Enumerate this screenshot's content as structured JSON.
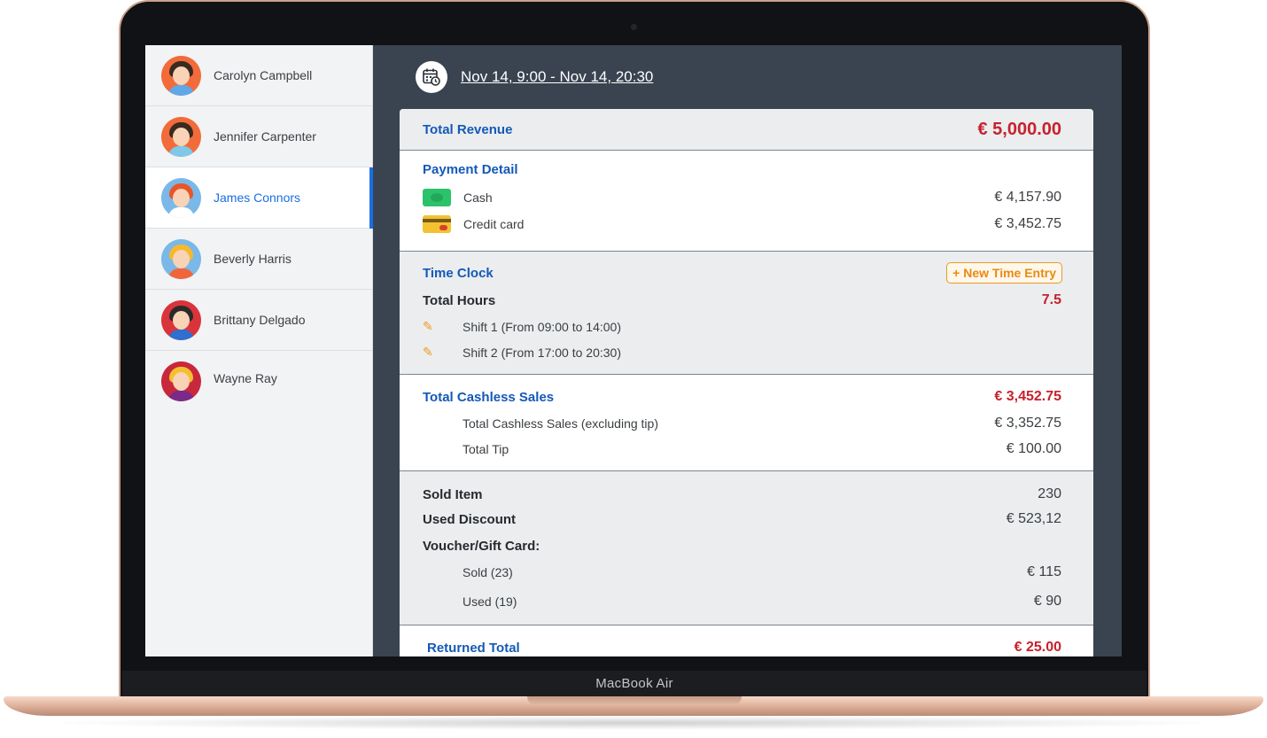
{
  "device": {
    "brand_label": "MacBook Air"
  },
  "sidebar": {
    "staff": [
      {
        "name": "Carolyn Campbell",
        "active": false,
        "avatar_bg": "#f26b3a",
        "hair": "#3a2a20",
        "body": "#5fa8e8"
      },
      {
        "name": "Jennifer Carpenter",
        "active": false,
        "avatar_bg": "#f26b3a",
        "hair": "#3a2a20",
        "body": "#7fc8e8"
      },
      {
        "name": "James Connors",
        "active": true,
        "avatar_bg": "#7ab8e8",
        "hair": "#e8562a",
        "body": "#ffffff"
      },
      {
        "name": "Beverly Harris",
        "active": false,
        "avatar_bg": "#7ab8e8",
        "hair": "#f5b82e",
        "body": "#f0663a"
      },
      {
        "name": "Brittany Delgado",
        "active": false,
        "avatar_bg": "#d9343a",
        "hair": "#2a2a2a",
        "body": "#2e6fcf"
      },
      {
        "name": "Wayne Ray",
        "active": false,
        "avatar_bg": "#c8283c",
        "hair": "#f5c02e",
        "body": "#7a2a8a"
      }
    ]
  },
  "header": {
    "date_range": "Nov 14, 9:00 - Nov 14, 20:30",
    "icon": "calendar-clock-icon"
  },
  "report": {
    "total_revenue": {
      "label": "Total Revenue",
      "value": "€ 5,000.00"
    },
    "payment_detail": {
      "title": "Payment Detail",
      "items": [
        {
          "label": "Cash",
          "value": "€ 4,157.90",
          "icon": "cash-icon"
        },
        {
          "label": "Credit card",
          "value": "€ 3,452.75",
          "icon": "credit-card-icon"
        }
      ]
    },
    "time_clock": {
      "title": "Time Clock",
      "new_entry_label": "+ New Time Entry",
      "total_hours_label": "Total Hours",
      "total_hours_value": "7.5",
      "shifts": [
        {
          "label": "Shift 1 (From 09:00 to 14:00)"
        },
        {
          "label": "Shift 2 (From 17:00 to 20:30)"
        }
      ]
    },
    "cashless": {
      "title": "Total Cashless Sales",
      "value": "€ 3,452.75",
      "items": [
        {
          "label": "Total Cashless Sales (excluding tip)",
          "value": "€ 3,352.75"
        },
        {
          "label": "Total Tip",
          "value": "€ 100.00"
        }
      ]
    },
    "summary": {
      "sold_item_label": "Sold Item",
      "sold_item_value": "230",
      "used_discount_label": "Used Discount",
      "used_discount_value": "€ 523,12",
      "voucher_label": "Voucher/Gift Card:",
      "voucher_items": [
        {
          "label": "Sold (23)",
          "value": "€ 115"
        },
        {
          "label": "Used (19)",
          "value": "€ 90"
        }
      ]
    },
    "returned": {
      "label": "Returned Total",
      "value": "€ 25.00"
    }
  }
}
